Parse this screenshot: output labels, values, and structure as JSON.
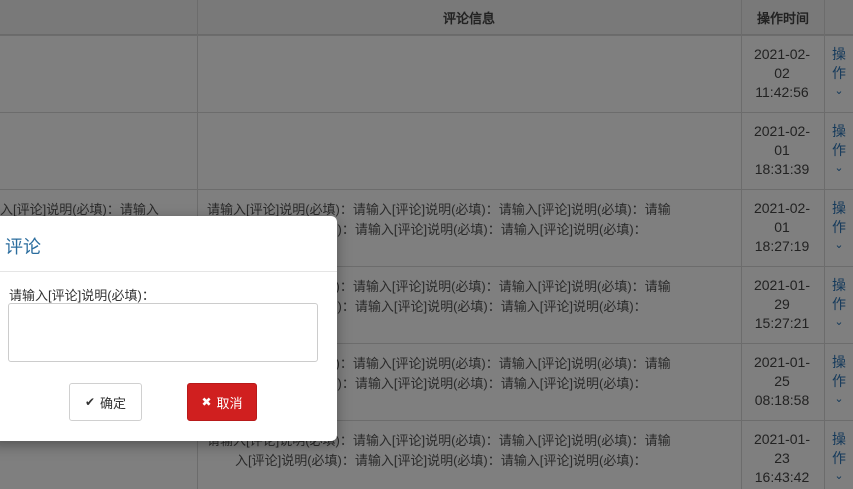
{
  "table": {
    "headers": {
      "comment_info": "评论信息",
      "op_time": "操作时间"
    },
    "comment_line_a": "请输入[评论]说明(必填)：请输入[评论]说明(必填)：请输入[评论]说明(必填)：请输",
    "comment_line_b": "入[评论]说明(必填)：请输入[评论]说明(必填)：请输入[评论]说明(必填)：",
    "left_col_partial": "入[评论]说明(必填)：请输入",
    "rows": [
      {
        "date1": "2021-02-",
        "date2": "02",
        "time": "11:42:56"
      },
      {
        "date1": "2021-02-",
        "date2": "01",
        "time": "18:31:39"
      },
      {
        "date1": "2021-02-",
        "date2": "01",
        "time": "18:27:19"
      },
      {
        "date1": "2021-01-",
        "date2": "29",
        "time": "15:27:21"
      },
      {
        "date1": "2021-01-",
        "date2": "25",
        "time": "08:18:58"
      },
      {
        "date1": "2021-01-",
        "date2": "23",
        "time": "16:43:42"
      }
    ],
    "op_label_1": "操",
    "op_label_2": "作"
  },
  "dialog": {
    "title": "评论",
    "label": "请输入[评论]说明(必填)：",
    "textarea_value": "",
    "ok_label": "确定",
    "cancel_label": "取消"
  }
}
